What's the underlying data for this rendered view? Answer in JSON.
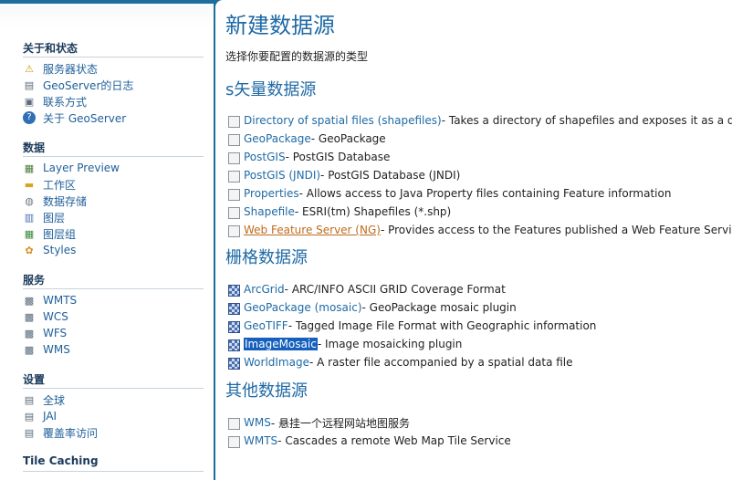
{
  "sidebar": {
    "sections": [
      {
        "title": "关于和状态",
        "items": [
          {
            "label": "服务器状态",
            "icon": "warning-icon"
          },
          {
            "label": "GeoServer的日志",
            "icon": "document-icon"
          },
          {
            "label": "联系方式",
            "icon": "contact-card-icon"
          },
          {
            "label": "关于 GeoServer",
            "icon": "help-icon"
          }
        ]
      },
      {
        "title": "数据",
        "items": [
          {
            "label": "Layer Preview",
            "icon": "map-preview-icon"
          },
          {
            "label": "工作区",
            "icon": "folder-icon"
          },
          {
            "label": "数据存储",
            "icon": "database-icon"
          },
          {
            "label": "图层",
            "icon": "layer-icon"
          },
          {
            "label": "图层组",
            "icon": "layer-group-icon"
          },
          {
            "label": "Styles",
            "icon": "palette-icon"
          }
        ]
      },
      {
        "title": "服务",
        "items": [
          {
            "label": "WMTS",
            "icon": "service-icon"
          },
          {
            "label": "WCS",
            "icon": "service-icon"
          },
          {
            "label": "WFS",
            "icon": "service-icon"
          },
          {
            "label": "WMS",
            "icon": "service-icon"
          }
        ]
      },
      {
        "title": "设置",
        "items": [
          {
            "label": "全球",
            "icon": "globe-settings-icon"
          },
          {
            "label": "JAI",
            "icon": "jai-icon"
          },
          {
            "label": "覆盖率访问",
            "icon": "coverage-access-icon"
          }
        ]
      },
      {
        "title": "Tile Caching",
        "items": []
      }
    ]
  },
  "main": {
    "title": "新建数据源",
    "subtitle": "选择你要配置的数据源的类型",
    "groups": [
      {
        "heading": "s矢量数据源",
        "items": [
          {
            "name": "Directory of spatial files (shapefiles)",
            "desc": " - Takes a directory of shapefiles and exposes it as a data store",
            "icon": "store"
          },
          {
            "name": "GeoPackage",
            "desc": " - GeoPackage",
            "icon": "store"
          },
          {
            "name": "PostGIS",
            "desc": " - PostGIS Database",
            "icon": "store"
          },
          {
            "name": "PostGIS (JNDI)",
            "desc": " - PostGIS Database (JNDI)",
            "icon": "store"
          },
          {
            "name": "Properties",
            "desc": " - Allows access to Java Property files containing Feature information",
            "icon": "store"
          },
          {
            "name": "Shapefile",
            "desc": " - ESRI(tm) Shapefiles (*.shp)",
            "icon": "store"
          },
          {
            "name": "Web Feature Server (NG)",
            "desc": " - Provides access to the Features published a Web Feature Service, and the",
            "icon": "wms",
            "state": "visited"
          }
        ]
      },
      {
        "heading": "栅格数据源",
        "items": [
          {
            "name": "ArcGrid",
            "desc": " - ARC/INFO ASCII GRID Coverage Format",
            "icon": "raster"
          },
          {
            "name": "GeoPackage (mosaic)",
            "desc": " - GeoPackage mosaic plugin",
            "icon": "raster"
          },
          {
            "name": "GeoTIFF",
            "desc": " - Tagged Image File Format with Geographic information",
            "icon": "raster"
          },
          {
            "name": "ImageMosaic",
            "desc": " - Image mosaicking plugin",
            "icon": "raster",
            "state": "selected"
          },
          {
            "name": "WorldImage",
            "desc": " - A raster file accompanied by a spatial data file",
            "icon": "raster"
          }
        ]
      },
      {
        "heading": "其他数据源",
        "items": [
          {
            "name": "WMS",
            "desc": " - 悬挂一个远程网站地图服务",
            "icon": "wms"
          },
          {
            "name": "WMTS",
            "desc": " - Cascades a remote Web Map Tile Service",
            "icon": "wms"
          }
        ]
      }
    ]
  }
}
